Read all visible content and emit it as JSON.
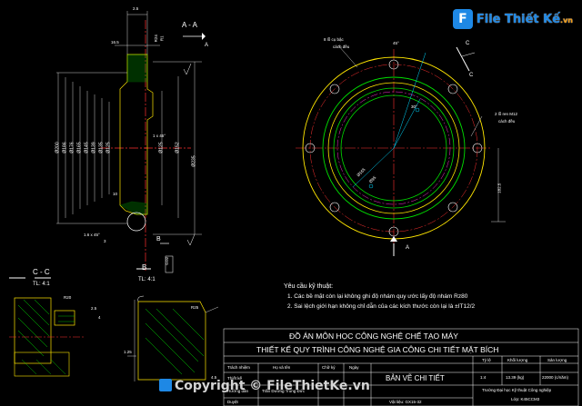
{
  "logo": {
    "brand": "File Thiết Kế",
    "domain": ".vn"
  },
  "watermark": "Copyright © FileThietKe.vn",
  "section_labels": {
    "aa": "A - A",
    "cc": "C - C",
    "cc_scale": "TL: 4:1",
    "b": "B",
    "b_scale": "TL: 4:1"
  },
  "section_letters": {
    "a_top": "A",
    "a_bottom": "A",
    "c_top": "C",
    "c_mid": "C",
    "b_mark": "B"
  },
  "dims_left": [
    "Ø200",
    "Ø186",
    "Ø176",
    "Ø165",
    "Ø145",
    "Ø139",
    "Ø135",
    "Ø125"
  ],
  "dims_right": [
    "Ø125",
    "Ø152",
    "Ø235"
  ],
  "dims_misc": [
    "2.5",
    "16.5",
    "R24",
    "R1",
    "1 x 45°",
    "1.6 x 45°",
    "R25",
    "R20",
    "2.5",
    "4",
    "0.02",
    "1.25",
    "10",
    "4.5",
    "3"
  ],
  "plan_notes": {
    "holes_top": "8 lỗ cụ bậc",
    "holes_top2": "cách đều",
    "holes_right": "2 lỗ ren M12",
    "holes_right2": "cách đều",
    "dim_165": "Ø165",
    "dim_95": "Ø95",
    "dim_r": "182.5",
    "angle": "45°",
    "angle2": "30°"
  },
  "requirements": {
    "title": "Yêu cầu kỹ thuật:",
    "items": [
      "1. Các bề mặt còn lại không ghi độ nhám quy ước lấy độ nhám Rz80",
      "2. Sai lệch giới hạn không chỉ dẫn của các kích thước còn lại là ±IT12/2"
    ]
  },
  "title_block": {
    "project": "ĐỒ ÁN MÔN HỌC CÔNG NGHỆ CHẾ TẠO MÁY",
    "subject": "THIẾT KẾ QUY TRÌNH CÔNG NGHỆ GIA CÔNG CHI TIẾT MẶT BÍCH",
    "headers": [
      "Trách nhiệm",
      "Họ và tên",
      "Chữ ký",
      "Ngày"
    ],
    "rows": [
      [
        "Thiết kế",
        "",
        "",
        ""
      ],
      [
        "Hướng dẫn",
        "Trần Dương Trung Đức",
        "",
        ""
      ],
      [
        "Duyệt",
        "",
        "",
        ""
      ]
    ],
    "drawing_name": "BẢN VẼ CHI TIẾT",
    "meta_headers": [
      "Tỷ lệ",
      "Khối lượng",
      "Sản lượng"
    ],
    "meta_values": [
      "1:4",
      "13.39 (kg)",
      "22000 (c/năm)"
    ],
    "material": "Vật liệu: GX15-32",
    "school": "Trường Đại học Kỹ thuật Công nghiệp",
    "class": "Lớp: K45CCM3"
  }
}
